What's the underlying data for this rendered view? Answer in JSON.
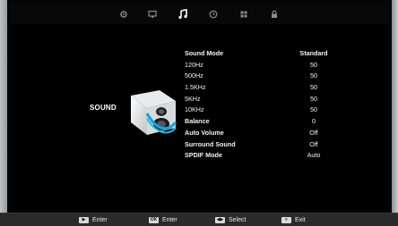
{
  "tabs": [
    {
      "icon": "gear-icon",
      "active": false
    },
    {
      "icon": "monitor-icon",
      "active": false
    },
    {
      "icon": "music-note-icon",
      "active": true
    },
    {
      "icon": "clock-icon",
      "active": false
    },
    {
      "icon": "grid-icon",
      "active": false
    },
    {
      "icon": "lock-icon",
      "active": false
    }
  ],
  "section": {
    "label": "SOUND",
    "icon": "speaker-icon"
  },
  "menu": [
    {
      "name": "Sound Mode",
      "value": "Standard"
    },
    {
      "name": "120Hz",
      "value": "50"
    },
    {
      "name": "500Hz",
      "value": "50"
    },
    {
      "name": "1.5KHz",
      "value": "50"
    },
    {
      "name": "5KHz",
      "value": "50"
    },
    {
      "name": "10KHz",
      "value": "50"
    },
    {
      "name": "Balance",
      "value": "0"
    },
    {
      "name": "Auto Volume",
      "value": "Off"
    },
    {
      "name": "Surround Sound",
      "value": "Off"
    },
    {
      "name": "SPDIF Mode",
      "value": "Auto"
    }
  ],
  "footer": [
    {
      "key_icon": "play-key-icon",
      "label": "Enter"
    },
    {
      "key_icon": "ok-key-icon",
      "label": "Enter"
    },
    {
      "key_icon": "select-key-icon",
      "label": "Select"
    },
    {
      "key_icon": "menu-key-icon",
      "label": "Exit"
    }
  ]
}
